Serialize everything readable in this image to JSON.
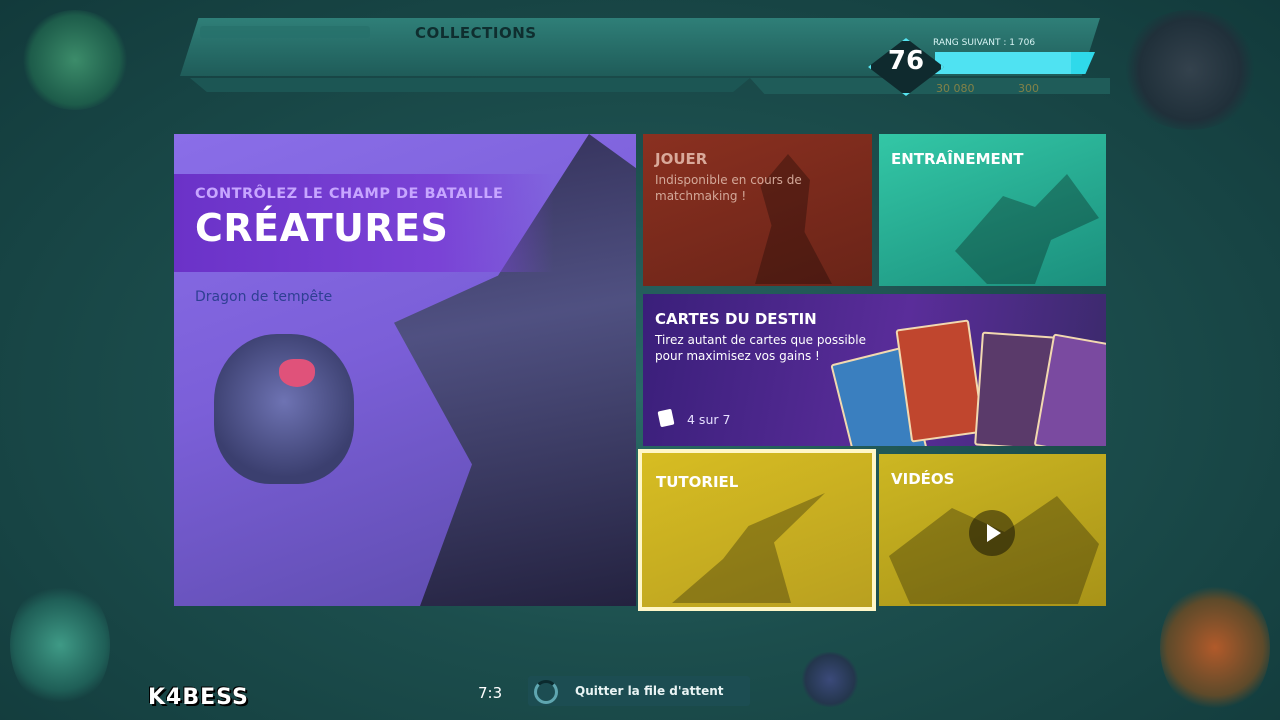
{
  "header": {
    "tab_collections": "COLLECTIONS",
    "rank_level": "76",
    "rank_next_label": "RANG SUIVANT : 1 706",
    "rank_progress": 0.85,
    "currency_gold": "30 080",
    "currency_gems": "300"
  },
  "featured": {
    "subtitle": "CONTRÔLEZ LE CHAMP DE BATAILLE",
    "title": "CRÉATURES",
    "link": "Dragon de tempête"
  },
  "tiles": {
    "play": {
      "title": "JOUER",
      "desc": "Indisponible en cours de matchmaking !"
    },
    "training": {
      "title": "ENTRAÎNEMENT"
    },
    "destiny": {
      "title": "CARTES DU DESTIN",
      "desc": "Tirez autant de cartes que possible pour maximisez vos gains !",
      "progress": "4 sur 7"
    },
    "tutorial": {
      "title": "TUTORIEL"
    },
    "videos": {
      "title": "VIDÉOS"
    }
  },
  "footer": {
    "watermark": "K4BESS",
    "timer": "7:3",
    "queue_label": "Quitter la file d'attent"
  },
  "colors": {
    "accent_cyan": "#2fd9ea",
    "featured_purple": "#7a43d6",
    "play_red": "#8a3020",
    "training_teal": "#33c7a6",
    "tutorial_yellow": "#d7bd22"
  },
  "icons": {
    "cards": "cards-icon",
    "play_video": "play-icon",
    "spinner": "loading-spinner-icon"
  }
}
